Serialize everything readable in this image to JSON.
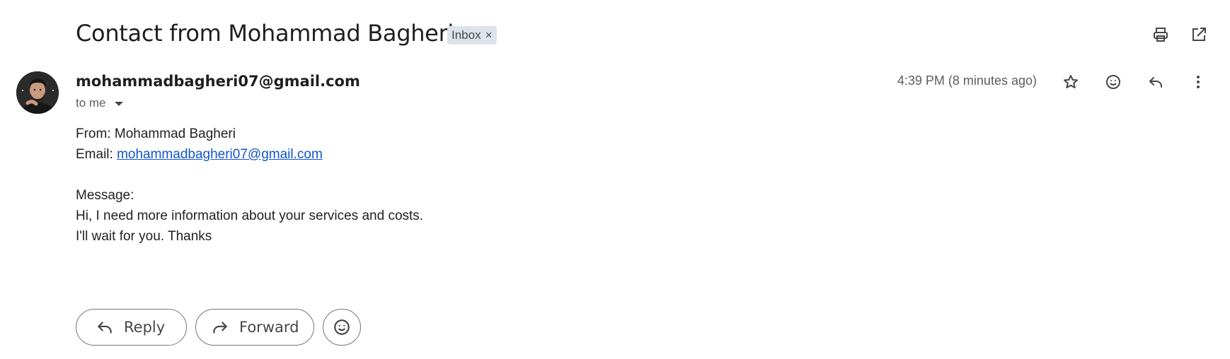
{
  "email": {
    "subject": "Contact from Mohammad Bagheri",
    "label": "Inbox",
    "label_remove": "×",
    "sender": "mohammadbagheri07@gmail.com",
    "recipient_summary": "to me",
    "timestamp": "4:39 PM (8 minutes ago)",
    "body": {
      "from_line": "From: Mohammad Bagheri",
      "email_prefix": "Email: ",
      "email_link": "mohammadbagheri07@gmail.com",
      "message_label": "Message:",
      "message_line1": "Hi, I need more information about your services and costs.",
      "message_line2": "I'll wait for you. Thanks"
    }
  },
  "toolbar": {
    "print_icon": "print-icon",
    "open_new_window_icon": "open-in-new-window-icon"
  },
  "header_actions": [
    "star-icon",
    "emoji-reaction-icon",
    "reply-icon",
    "more-vert-icon"
  ],
  "footer_actions": {
    "reply_label": "Reply",
    "forward_label": "Forward"
  },
  "colors": {
    "link": "#1155cc",
    "label_chip_bg": "#dde3ea",
    "secondary_text": "#5e5e5e"
  }
}
